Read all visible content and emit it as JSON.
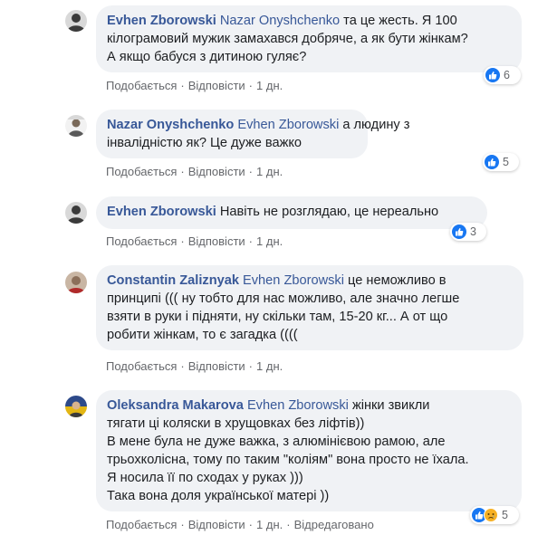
{
  "comments": [
    {
      "author": "Evhen Zborowski",
      "mention": "Nazar Onyshchenko",
      "lines": [
        " та це жесть. Я 100",
        "кілограмовий мужик замахався добряче, а як бути жінкам?",
        "А якщо бабуся з дитиною гуляє?"
      ],
      "like": "Подобається",
      "reply": "Відповісти",
      "time": "1 дн.",
      "reactions": "6",
      "avatar_color": "#3b3b3b"
    },
    {
      "author": "Nazar Onyshchenko",
      "mention": "Evhen Zborowski",
      "lines": [
        " а людину з",
        "інвалідністю як? Це дуже важко"
      ],
      "like": "Подобається",
      "reply": "Відповісти",
      "time": "1 дн.",
      "reactions": "5",
      "avatar_color": "#e6e6e6"
    },
    {
      "author": "Evhen Zborowski",
      "mention": "",
      "lines": [
        " Навіть не розглядаю, це нереально"
      ],
      "like": "Подобається",
      "reply": "Відповісти",
      "time": "1 дн.",
      "reactions": "3",
      "avatar_color": "#3b3b3b"
    },
    {
      "author": "Constantin Zaliznyak",
      "mention": "Evhen Zborowski",
      "lines": [
        " це неможливо в",
        "принципі ((( ну тобто для нас можливо, але значно легше",
        "взяти в руки і підняти, ну скільки там, 15-20 кг... А от що",
        "робити жінкам, то є загадка (((("
      ],
      "like": "Подобається",
      "reply": "Відповісти",
      "time": "1 дн.",
      "reactions": "",
      "avatar_color": "#8b6f5a"
    },
    {
      "author": "Oleksandra Makarova",
      "mention": "Evhen Zborowski",
      "lines": [
        " жінки звикли",
        "тягати ці коляски в хрущовках без ліфтів))",
        "В мене була не дуже важка, з алюмінієвою рамою, але",
        "трьохколісна, тому по таким \"коліям\" вона просто не їхала.",
        "Я носила її по сходах у руках )))",
        "Така вона доля української матері ))"
      ],
      "like": "Подобається",
      "reply": "Відповісти",
      "time": "1 дн.",
      "edited": "Відредаговано",
      "reactions": "5",
      "avatar_color": "#2d4a8a"
    }
  ],
  "colors": {
    "bubble": "#f0f2f5",
    "author": "#385898",
    "meta": "#65676b",
    "like": "#1877f2",
    "sad": "#f7b125"
  },
  "icons": {
    "like": "like-reaction-icon",
    "sad": "sad-reaction-icon"
  }
}
